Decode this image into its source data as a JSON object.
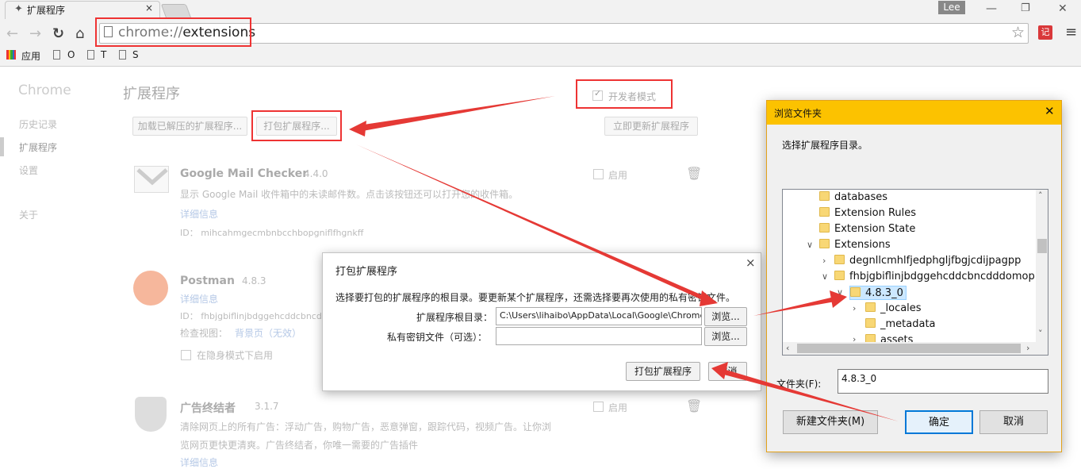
{
  "browser": {
    "tab_title": "扩展程序",
    "tab_close": "×",
    "user": "Lee",
    "url_prefix": "chrome://",
    "url_path": "extensions",
    "bookmarks": [
      "应用",
      "O",
      "T",
      "S"
    ]
  },
  "sidebar": {
    "title": "Chrome",
    "items": [
      "历史记录",
      "扩展程序",
      "设置",
      "关于"
    ]
  },
  "main": {
    "title": "扩展程序",
    "dev_mode_label": "开发者模式",
    "load_unpacked": "加载已解压的扩展程序...",
    "pack_extension": "打包扩展程序...",
    "update_now": "立即更新扩展程序",
    "enable_label": "启用"
  },
  "extensions": [
    {
      "name": "Google Mail Checker",
      "version": "4.4.0",
      "desc": "显示 Google Mail 收件箱中的未读邮件数。点击该按钮还可以打开您的收件箱。",
      "details": "详细信息",
      "id": "ID： mihcahmgecmbnbcchbopgniflfhgnkff"
    },
    {
      "name": "Postman",
      "version": "4.8.3",
      "details": "详细信息",
      "id": "ID： fhbjgbiflinjbdggehcddcbncdddomop",
      "inspect": "检查视图：",
      "background": "背景页（无效）",
      "incognito": "在隐身模式下启用"
    },
    {
      "name": "广告终结者",
      "version": "3.1.7",
      "desc1": "清除网页上的所有广告：浮动广告，购物广告，恶意弹窗，跟踪代码，视频广告。让你浏",
      "desc2": "览网页更快更清爽。广告终结者，你唯一需要的广告插件",
      "details": "详细信息"
    }
  ],
  "pack_dialog": {
    "title": "打包扩展程序",
    "close": "×",
    "instruction": "选择要打包的扩展程序的根目录。要更新某个扩展程序，还需选择要再次使用的私有密钥文件。",
    "root_label": "扩展程序根目录：",
    "root_value": "C:\\Users\\lihaibo\\AppData\\Local\\Google\\Chrome",
    "key_label": "私有密钥文件（可选）：",
    "key_value": "",
    "browse": "浏览...",
    "pack_button": "打包扩展程序",
    "cancel": "取消"
  },
  "folder_dialog": {
    "title": "浏览文件夹",
    "close": "✕",
    "prompt": "选择扩展程序目录。",
    "tree": [
      "databases",
      "Extension Rules",
      "Extension State",
      "Extensions",
      "degnllcmhlfjedphgljfbgjcdijpagpp",
      "fhbjgbiflinjbdggehcddcbncdddomop",
      "4.8.3_0",
      "_locales",
      "_metadata",
      "assets"
    ],
    "folder_label": "文件夹(F):",
    "folder_value": "4.8.3_0",
    "new_folder": "新建文件夹(M)",
    "ok": "确定",
    "cancel": "取消"
  },
  "colors": {
    "annotation_red": "#e53935",
    "dialog_title_bg": "#fcc200",
    "tree_selected_bg": "#cce8ff"
  }
}
